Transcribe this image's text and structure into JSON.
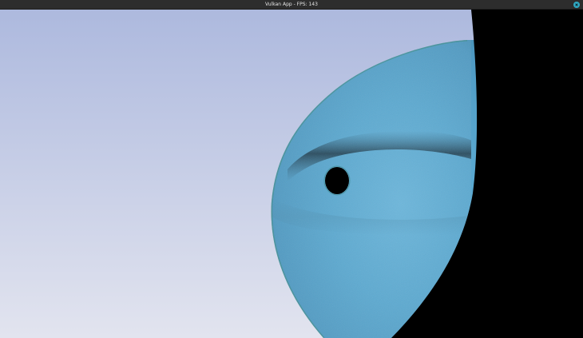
{
  "window": {
    "title": "Vulkan App - FPS: 143"
  },
  "icons": {
    "close": "close-icon"
  },
  "colors": {
    "titlebar": "#2d2d2d",
    "close_button": "#2fa9c3",
    "sky_top": "#adb9de",
    "sky_bottom": "#e2e4ef",
    "sphere_light": "#5fb1d8",
    "sphere_dark": "#2b4f66",
    "sphere_edge": "#3a8b7f",
    "shadow": "#000000"
  }
}
